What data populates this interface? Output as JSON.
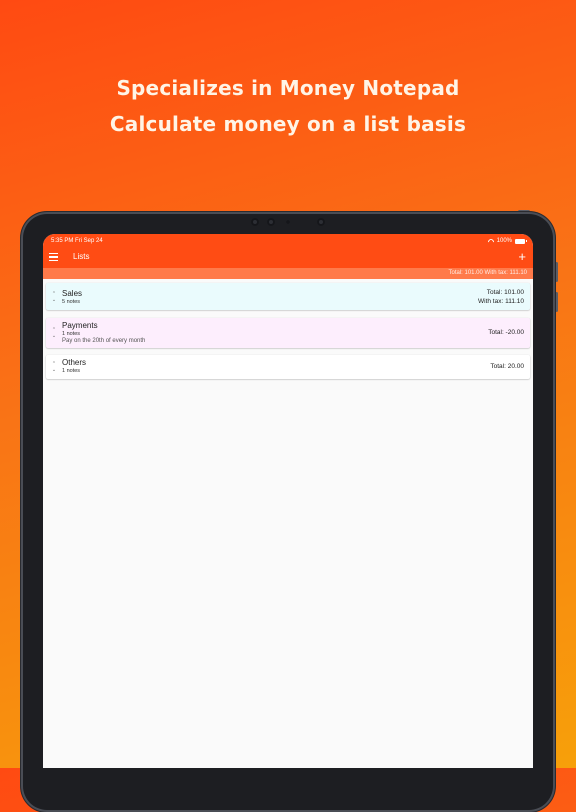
{
  "headline": {
    "line1": "Specializes in Money Notepad",
    "line2": "Calculate money on a list basis"
  },
  "status_bar": {
    "time": "5:35 PM   Fri Sep 24",
    "battery": "100%"
  },
  "app_bar": {
    "title": "Lists",
    "add_symbol": "+"
  },
  "summary": {
    "text": "Total: 101.00 With tax: 111.10"
  },
  "lists": [
    {
      "name": "Sales",
      "notes": "5 notes",
      "memo": "",
      "total": "Total: 101.00",
      "with_tax": "With tax: 111.10",
      "color": "#eafbfd"
    },
    {
      "name": "Payments",
      "notes": "1 notes",
      "memo": "Pay on the 20th of every month",
      "total": "Total: -20.00",
      "with_tax": "",
      "color": "#fdeefd"
    },
    {
      "name": "Others",
      "notes": "1 notes",
      "memo": "",
      "total": "Total: 20.00",
      "with_tax": "",
      "color": "#ffffff"
    }
  ],
  "colors": {
    "accent": "#ff4c14",
    "summary_bar": "#ff7a4a",
    "background_top": "#ff4a12",
    "background_bottom": "#f7a00a"
  },
  "icons": {
    "menu": "hamburger-menu-icon",
    "add": "plus-icon",
    "reorder": "chevron-up-down-icon",
    "wifi": "wifi-icon",
    "battery": "battery-icon"
  }
}
